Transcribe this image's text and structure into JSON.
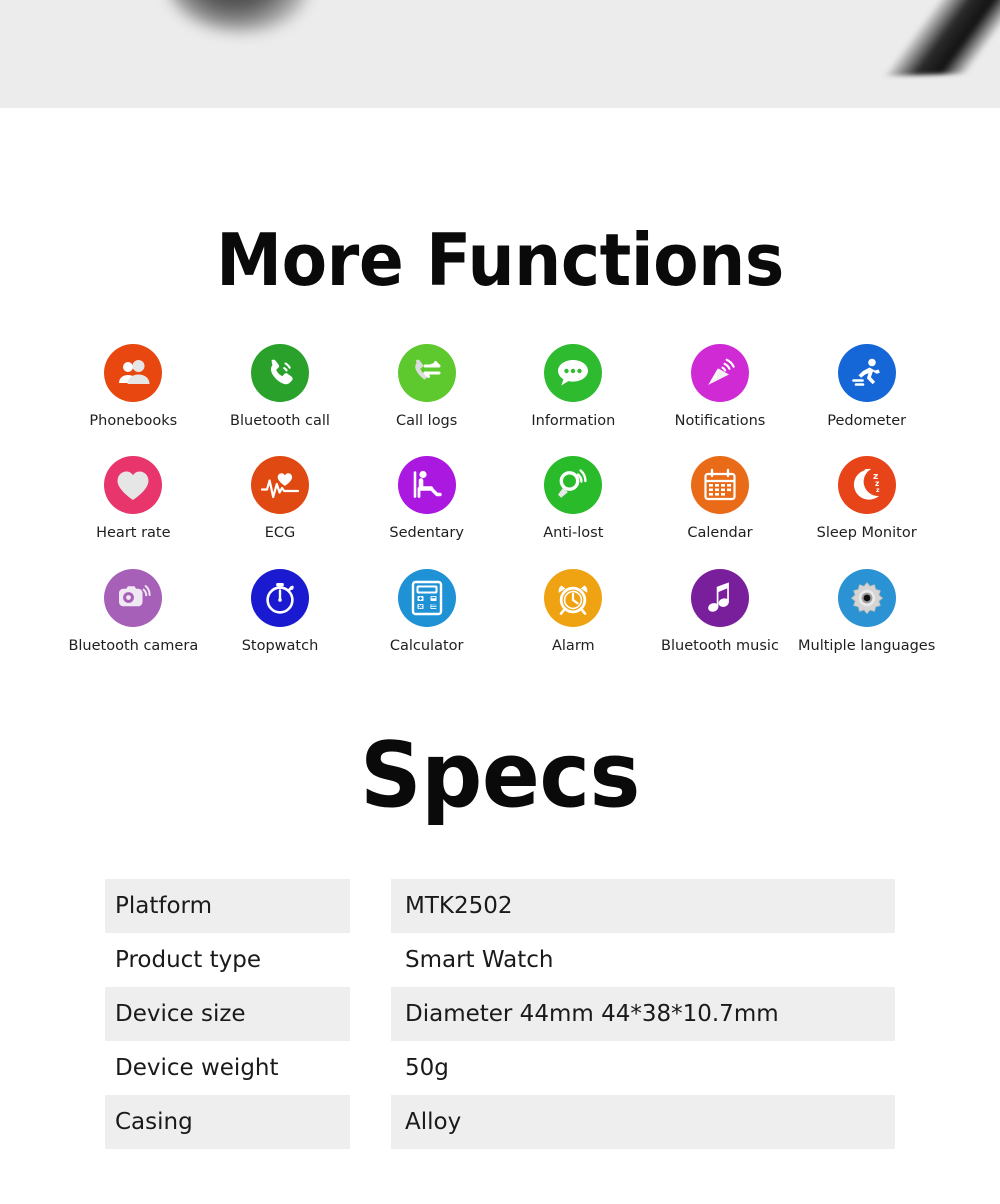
{
  "hero": {
    "alt": "product-photo-strip"
  },
  "functions": {
    "heading": "More Functions",
    "items": [
      {
        "label": "Phonebooks",
        "icon": "contacts-icon",
        "color": "#e8470f"
      },
      {
        "label": "Bluetooth call",
        "icon": "phone-call-icon",
        "color": "#2aa12a"
      },
      {
        "label": "Call logs",
        "icon": "call-transfer-icon",
        "color": "#5ec92e"
      },
      {
        "label": "Information",
        "icon": "chat-bubble-icon",
        "color": "#2fbb2f"
      },
      {
        "label": "Notifications",
        "icon": "satellite-dish-icon",
        "color": "#cf2ad4"
      },
      {
        "label": "Pedometer",
        "icon": "running-person-icon",
        "color": "#1566d6"
      },
      {
        "label": "Heart rate",
        "icon": "heart-icon",
        "color": "#e8356b"
      },
      {
        "label": "ECG",
        "icon": "ecg-waveform-icon",
        "color": "#e04a12"
      },
      {
        "label": "Sedentary",
        "icon": "seated-person-icon",
        "color": "#ab18e0"
      },
      {
        "label": "Anti-lost",
        "icon": "magnifier-signal-icon",
        "color": "#29bb29"
      },
      {
        "label": "Calendar",
        "icon": "calendar-icon",
        "color": "#e96b18"
      },
      {
        "label": "Sleep Monitor",
        "icon": "moon-zzz-icon",
        "color": "#e8441a"
      },
      {
        "label": "Bluetooth camera",
        "icon": "camera-signal-icon",
        "color": "#a760b8"
      },
      {
        "label": "Stopwatch",
        "icon": "stopwatch-icon",
        "color": "#1a1ad0"
      },
      {
        "label": "Calculator",
        "icon": "calculator-icon",
        "color": "#1f92d6"
      },
      {
        "label": "Alarm",
        "icon": "alarm-clock-icon",
        "color": "#efa313"
      },
      {
        "label": "Bluetooth music",
        "icon": "music-note-icon",
        "color": "#7a1f9c"
      },
      {
        "label": "Multiple languages",
        "icon": "gear-icon",
        "color": "#2b93d4"
      }
    ]
  },
  "specs": {
    "heading": "Specs",
    "rows": [
      {
        "key": "Platform",
        "value": "MTK2502"
      },
      {
        "key": "Product type",
        "value": "Smart Watch"
      },
      {
        "key": "Device size",
        "value": "Diameter 44mm  44*38*10.7mm"
      },
      {
        "key": "Device weight",
        "value": "50g"
      },
      {
        "key": "Casing",
        "value": "Alloy"
      }
    ]
  },
  "theme": {
    "row_shade": "#eeeeee",
    "text": "#1a1a1a",
    "strip_bg": "#ececec"
  }
}
